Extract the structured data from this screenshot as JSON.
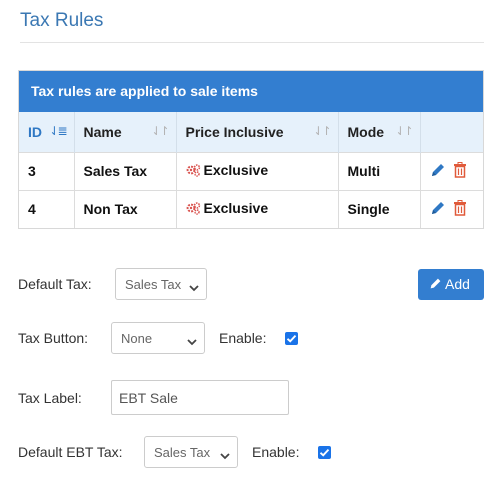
{
  "page": {
    "title": "Tax Rules"
  },
  "panel": {
    "heading": "Tax rules are applied to sale items"
  },
  "table": {
    "headers": {
      "id": "ID",
      "name": "Name",
      "price_inclusive": "Price Inclusive",
      "mode": "Mode"
    },
    "rows": [
      {
        "id": "3",
        "name": "Sales Tax",
        "price_inclusive": "Exclusive",
        "mode": "Multi"
      },
      {
        "id": "4",
        "name": "Non Tax",
        "price_inclusive": "Exclusive",
        "mode": "Single"
      }
    ]
  },
  "form": {
    "default_tax": {
      "label": "Default Tax:",
      "value": "Sales Tax"
    },
    "add_button": {
      "label": "Add"
    },
    "tax_button": {
      "label": "Tax Button:",
      "value": "None",
      "enable_label": "Enable:",
      "enabled": true
    },
    "tax_label": {
      "label": "Tax Label:",
      "value": "EBT Sale"
    },
    "default_ebt_tax": {
      "label": "Default EBT Tax:",
      "value": "Sales Tax",
      "enable_label": "Enable:",
      "enabled": true
    }
  },
  "icons": {
    "gear": "gears-icon",
    "edit": "pencil-icon",
    "delete": "trash-icon",
    "add": "pencil-icon"
  },
  "colors": {
    "accent": "#337ed0",
    "title": "#3b78b3",
    "header_bg": "#e6f1fb",
    "edit": "#2f78c4",
    "delete": "#e05a3a"
  }
}
